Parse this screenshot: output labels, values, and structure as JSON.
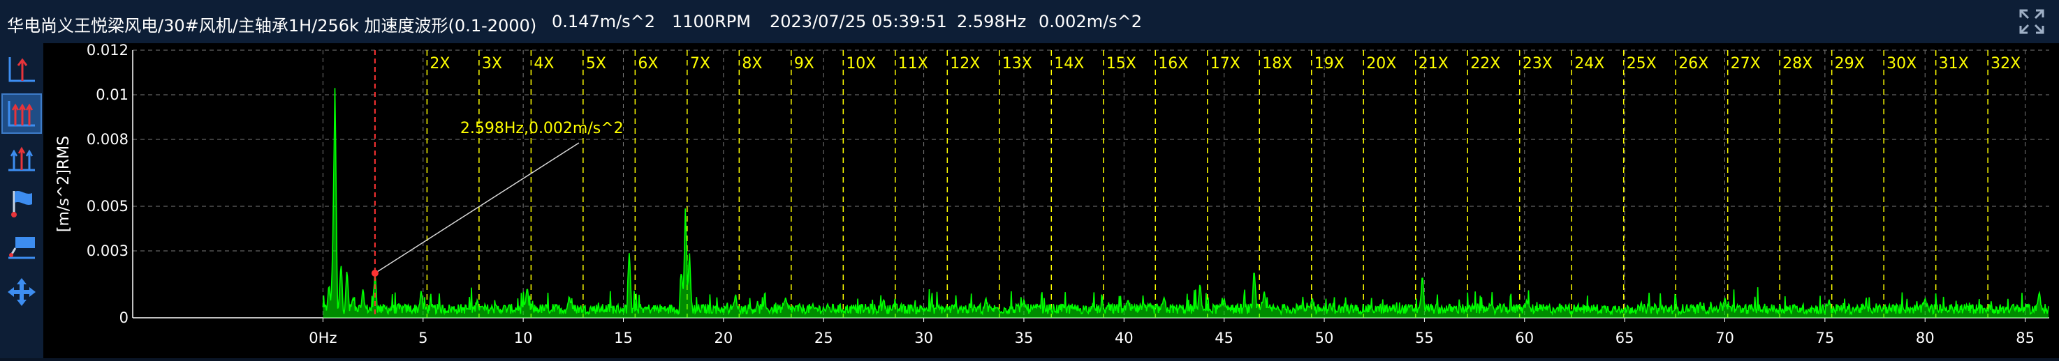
{
  "header": {
    "path": "华电尚义王悦梁风电/30#风机/主轴承1H/256k 加速度波形(0.1-2000)",
    "rms": "0.147m/s^2",
    "speed": "1100RPM",
    "datetime": "2023/07/25 05:39:51",
    "cursor_freq": "2.598Hz",
    "cursor_amp": "0.002m/s^2"
  },
  "toolbar": {
    "tools": [
      {
        "name": "single-cursor-tool",
        "icon": "single-cursor-icon"
      },
      {
        "name": "harmonic-cursor-tool",
        "icon": "harmonic-cursor-icon",
        "active": true
      },
      {
        "name": "sideband-cursor-tool",
        "icon": "sideband-cursor-icon"
      },
      {
        "name": "flag-tool",
        "icon": "flag-icon"
      },
      {
        "name": "annotation-tool",
        "icon": "annotation-icon"
      },
      {
        "name": "pan-tool",
        "icon": "move-icon"
      }
    ]
  },
  "colors": {
    "spectrum": "#00ff00",
    "harmonic_lines": "#ffff00",
    "cursor_line": "#ff3333",
    "grid": "#7a7a7a",
    "annotation": "#ffff00"
  },
  "chart_data": {
    "type": "line",
    "ylabel": "[m/s^2]RMS",
    "x_unit_label": "0Hz",
    "xlim": [
      -9.5,
      86.2
    ],
    "ylim": [
      0,
      0.012
    ],
    "x_ticks": [
      0,
      5,
      10,
      15,
      20,
      25,
      30,
      35,
      40,
      45,
      50,
      55,
      60,
      65,
      70,
      75,
      80,
      85
    ],
    "x_tick_labels": [
      "0Hz",
      "5",
      "10",
      "15",
      "20",
      "25",
      "30",
      "35",
      "40",
      "45",
      "50",
      "55",
      "60",
      "65",
      "70",
      "75",
      "80",
      "85"
    ],
    "y_ticks": [
      0,
      0.003,
      0.005,
      0.008,
      0.01,
      0.012
    ],
    "y_tick_labels": [
      "0",
      "0.003",
      "0.005",
      "0.008",
      "0.01",
      "0.012"
    ],
    "grid": true,
    "cursor": {
      "x": 2.598,
      "y": 0.002,
      "label": "2.598Hz,0.002m/s^2"
    },
    "harmonics": {
      "fundamental": 2.598,
      "labels": [
        "2X",
        "3X",
        "4X",
        "5X",
        "6X",
        "7X",
        "8X",
        "9X",
        "10X",
        "11X",
        "12X",
        "13X",
        "14X",
        "15X",
        "16X",
        "17X",
        "18X",
        "19X",
        "20X",
        "21X",
        "22X",
        "23X",
        "24X",
        "25X",
        "26X",
        "27X",
        "28X",
        "29X",
        "30X",
        "31X",
        "32X"
      ]
    },
    "peaks": [
      {
        "x": 0.3,
        "y": 0.0015
      },
      {
        "x": 0.5,
        "y": 0.003
      },
      {
        "x": 0.6,
        "y": 0.0107
      },
      {
        "x": 0.9,
        "y": 0.0025
      },
      {
        "x": 1.2,
        "y": 0.0022
      },
      {
        "x": 1.5,
        "y": 0.0009
      },
      {
        "x": 2.0,
        "y": 0.0013
      },
      {
        "x": 2.6,
        "y": 0.0021
      },
      {
        "x": 4.9,
        "y": 0.0012
      },
      {
        "x": 7.7,
        "y": 0.0008
      },
      {
        "x": 10.2,
        "y": 0.0014
      },
      {
        "x": 12.3,
        "y": 0.001
      },
      {
        "x": 15.3,
        "y": 0.003
      },
      {
        "x": 17.9,
        "y": 0.0022
      },
      {
        "x": 18.1,
        "y": 0.0051
      },
      {
        "x": 18.3,
        "y": 0.003
      },
      {
        "x": 20.6,
        "y": 0.0011
      },
      {
        "x": 23.1,
        "y": 0.0009
      },
      {
        "x": 28.0,
        "y": 0.0008
      },
      {
        "x": 33.1,
        "y": 0.0009
      },
      {
        "x": 35.0,
        "y": 0.0008
      },
      {
        "x": 40.2,
        "y": 0.0008
      },
      {
        "x": 42.0,
        "y": 0.0009
      },
      {
        "x": 43.8,
        "y": 0.0016
      },
      {
        "x": 45.0,
        "y": 0.0009
      },
      {
        "x": 46.5,
        "y": 0.0022
      },
      {
        "x": 47.0,
        "y": 0.0012
      },
      {
        "x": 49.4,
        "y": 0.0009
      },
      {
        "x": 54.9,
        "y": 0.002
      },
      {
        "x": 60.1,
        "y": 0.0008
      },
      {
        "x": 70.0,
        "y": 0.0009
      },
      {
        "x": 75.2,
        "y": 0.0008
      },
      {
        "x": 80.0,
        "y": 0.0009
      },
      {
        "x": 85.7,
        "y": 0.0012
      }
    ],
    "noise_floor": 0.0005
  }
}
